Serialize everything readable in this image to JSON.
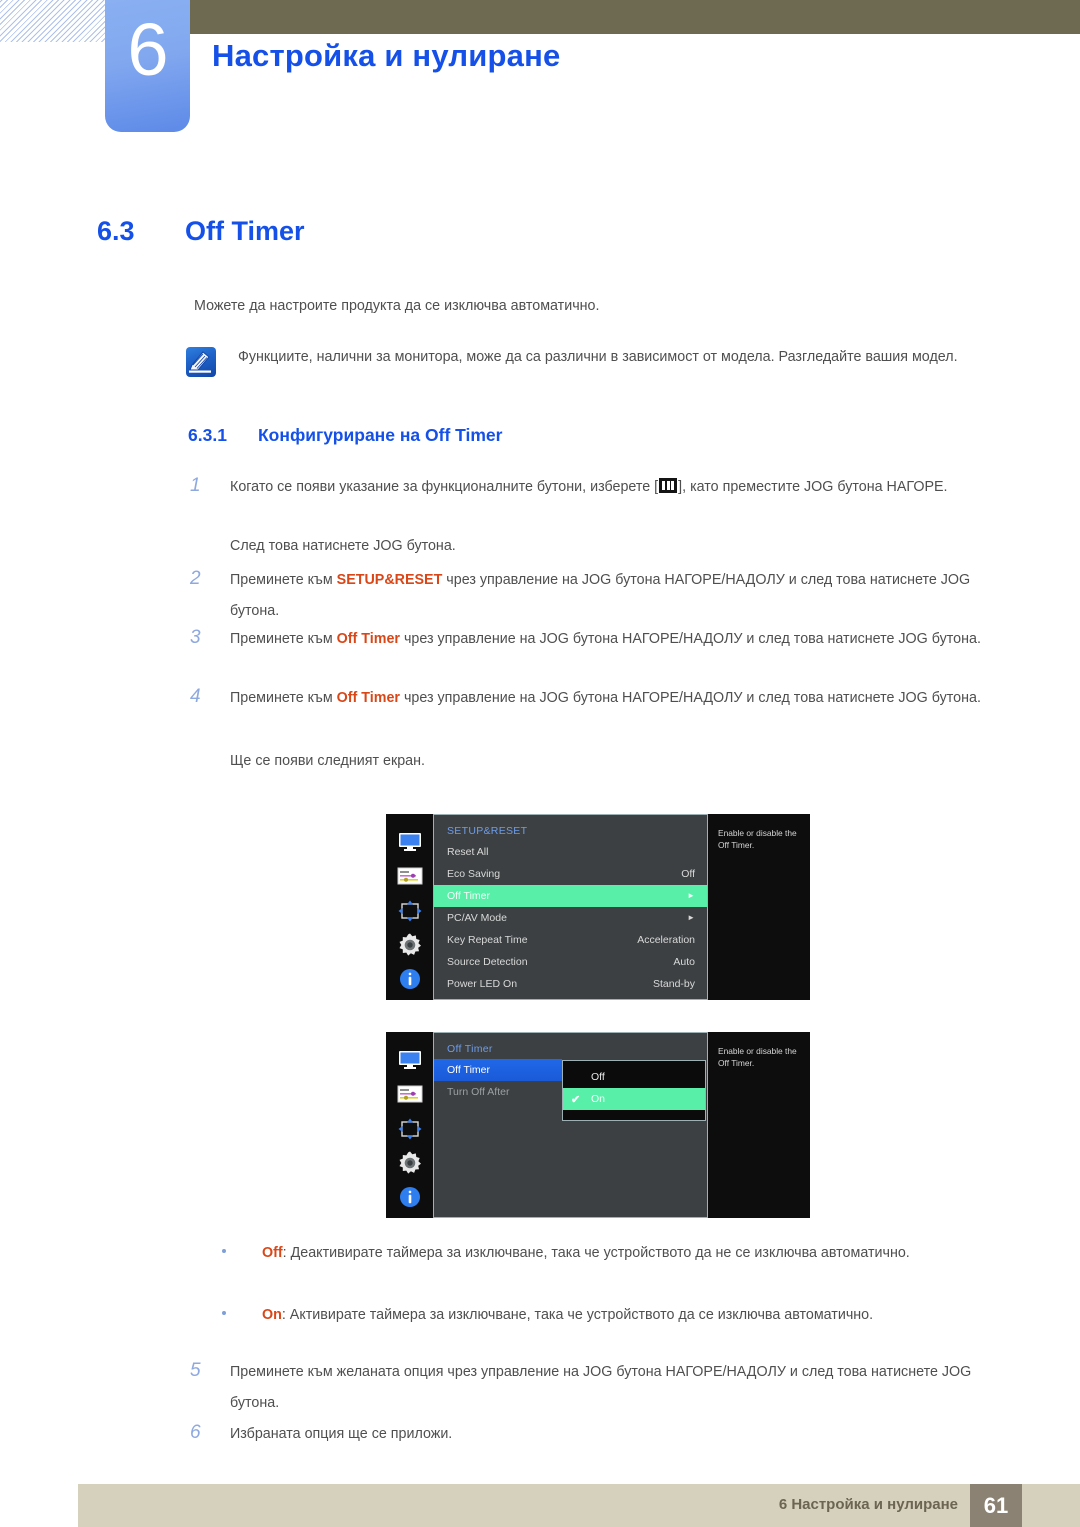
{
  "chapter": {
    "number": "6",
    "title": "Настройка и нулиране"
  },
  "section": {
    "number": "6.3",
    "title": "Off Timer"
  },
  "intro": "Можете да настроите продукта да се изключва автоматично.",
  "note": {
    "icon": "note-pencil-icon",
    "text": "Функциите, налични за монитора, може да са различни в зависимост от модела. Разгледайте вашия модел."
  },
  "subsection": {
    "number": "6.3.1",
    "title": "Конфигуриране на Off Timer"
  },
  "steps": [
    {
      "num": "1",
      "part_a": "Когато се появи указание за функционалните бутони, изберете [",
      "part_b": "], като преместите JOG бутона НАГОРЕ.",
      "extra": "След това натиснете JOG бутона."
    },
    {
      "num": "2",
      "pre": "Преминете към ",
      "bold": "SETUP&RESET",
      "post": " чрез управление на JOG бутона НАГОРЕ/НАДОЛУ и след това натиснете JOG бутона."
    },
    {
      "num": "3",
      "pre": "Преминете към ",
      "bold": "Off Timer",
      "post": " чрез управление на JOG бутона НАГОРЕ/НАДОЛУ и след това натиснете JOG бутона."
    },
    {
      "num": "4",
      "pre": "Преминете към ",
      "bold": "Off Timer",
      "post": " чрез управление на JOG бутона НАГОРЕ/НАДОЛУ и след това натиснете JOG бутона.",
      "extra": "Ще се появи следният екран."
    },
    {
      "num": "5",
      "pre": "",
      "bold": "",
      "post": "Преминете към желаната опция чрез управление на JOG бутона НАГОРЕ/НАДОЛУ и след това натиснете JOG бутона."
    },
    {
      "num": "6",
      "pre": "",
      "bold": "",
      "post": "Избраната опция ще се приложи."
    }
  ],
  "bullets": [
    {
      "bold": "Off",
      "text": ": Деактивирате таймера за изключване, така че устройството да не се изключва автоматично."
    },
    {
      "bold": "On",
      "text": ": Активирате таймера за изключване, така че устройството да се изключва автоматично."
    }
  ],
  "osd1": {
    "heading": "SETUP&RESET",
    "help": "Enable or disable the Off Timer.",
    "icons": [
      "monitor-icon",
      "picture-settings-icon",
      "screen-adjust-icon",
      "gear-icon",
      "info-icon"
    ],
    "rows": [
      {
        "label": "Reset All",
        "value": "",
        "state": "normal"
      },
      {
        "label": "Eco Saving",
        "value": "Off",
        "state": "normal"
      },
      {
        "label": "Off Timer",
        "value": "►",
        "state": "selected"
      },
      {
        "label": "PC/AV Mode",
        "value": "►",
        "state": "normal"
      },
      {
        "label": "Key Repeat Time",
        "value": "Acceleration",
        "state": "normal"
      },
      {
        "label": "Source Detection",
        "value": "Auto",
        "state": "normal"
      },
      {
        "label": "Power LED On",
        "value": "Stand-by",
        "state": "normal"
      }
    ]
  },
  "osd2": {
    "heading": "Off Timer",
    "help": "Enable or disable the Off Timer.",
    "icons": [
      "monitor-icon",
      "picture-settings-icon",
      "screen-adjust-icon",
      "gear-icon",
      "info-icon"
    ],
    "rows": [
      {
        "label": "Off Timer",
        "state": "highlighted"
      },
      {
        "label": "Turn Off After",
        "state": "dim"
      }
    ],
    "popup": {
      "options": [
        {
          "label": "Off",
          "checked": false
        },
        {
          "label": "On",
          "checked": true
        }
      ],
      "check_glyph": "✔"
    }
  },
  "footer": {
    "text": "6 Настройка и нулиране",
    "page": "61"
  },
  "colors": {
    "accent_blue": "#1550e8",
    "olive": "#6d6a51",
    "chapter_blue": "#81a7ef",
    "red_bold": "#d94718",
    "osd_green": "#58efa8",
    "osd_blue": "#2068e8",
    "footer_bar": "#d6d1bd",
    "footer_page_box": "#8c8273"
  }
}
